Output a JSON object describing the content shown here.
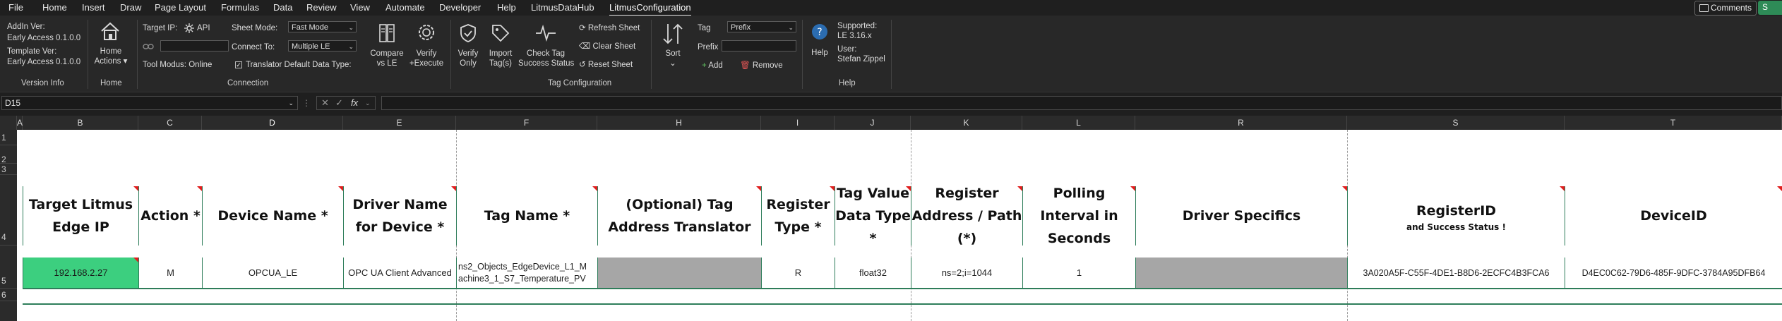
{
  "menu": {
    "items": [
      "File",
      "Home",
      "Insert",
      "Draw",
      "Page Layout",
      "Formulas",
      "Data",
      "Review",
      "View",
      "Automate",
      "Developer",
      "Help",
      "LitmusDataHub",
      "LitmusConfiguration"
    ],
    "active": "LitmusConfiguration",
    "comments_label": "Comments",
    "share_initial": "S"
  },
  "ribbon": {
    "version_info": {
      "addin_ver_label": "AddIn Ver:",
      "addin_ver_value": "Early Access 0.1.0.0",
      "template_ver_label": "Template Ver:",
      "template_ver_value": "Early Access 0.1.0.0",
      "group_label": "Version Info"
    },
    "home": {
      "button_line1": "Home",
      "button_line2": "Actions",
      "group_label": "Home"
    },
    "connection": {
      "target_ip_label": "Target IP:",
      "api_label": "API",
      "sheet_mode_label": "Sheet Mode:",
      "sheet_mode_value": "Fast Mode",
      "connect_to_label": "Connect To:",
      "connect_to_value": "Multiple LE",
      "tool_modus": "Tool Modus: Online",
      "translator_default": "Translator Default Data Type:",
      "compare_line1": "Compare",
      "compare_line2": "vs LE",
      "verify_line1": "Verify",
      "verify_line2": "+Execute",
      "group_label": "Connection"
    },
    "tag_config": {
      "verify_only_line1": "Verify",
      "verify_only_line2": "Only",
      "import_line1": "Import",
      "import_line2": "Tag(s)",
      "check_line1": "Check Tag",
      "check_line2": "Success Status",
      "refresh_sheet": "Refresh Sheet",
      "clear_sheet": "Clear Sheet",
      "reset_sheet": "Reset Sheet",
      "sort_label": "Sort",
      "tag_label": "Tag",
      "tag_value": "Prefix",
      "prefix_label": "Prefix",
      "add_label": "Add",
      "remove_label": "Remove",
      "group_label": "Tag Configuration"
    },
    "help": {
      "help_label": "Help",
      "supported_label": "Supported:",
      "supported_value": "LE 3.16.x",
      "user_label": "User:",
      "user_value": "Stefan Zippel",
      "group_label": "Help"
    }
  },
  "formula_bar": {
    "cell_ref": "D15",
    "fx": "fx",
    "formula": ""
  },
  "grid": {
    "columns": [
      "A",
      "B",
      "C",
      "D",
      "E",
      "F",
      "H",
      "I",
      "J",
      "K",
      "L",
      "R",
      "S",
      "T"
    ],
    "rows": [
      "1",
      "2",
      "3",
      "4",
      "5",
      "6"
    ],
    "headers": {
      "target_ip": "Target Litmus Edge IP",
      "action": "Action *",
      "device_name": "Device Name *",
      "driver_name": "Driver Name for Device *",
      "tag_name": "Tag Name *",
      "translator": "(Optional) Tag Address Translator",
      "register_type": "Register Type *",
      "value_type": "Tag Value Data Type *",
      "register_address": "Register Address / Path (*)",
      "polling": "Polling Interval in Seconds",
      "driver_specifics": "Driver Specifics",
      "register_id": "RegisterID",
      "register_id_sub": "and Success Status !",
      "device_id": "DeviceID"
    },
    "row5": {
      "target_ip": "192.168.2.27",
      "action": "M",
      "device_name": "OPCUA_LE",
      "driver_name": "OPC UA Client Advanced",
      "tag_name_line1": "ns2_Objects_EdgeDevice_L1_M",
      "tag_name_line2": "achine3_1_S7_Temperature_PV",
      "translator": "",
      "register_type": "R",
      "value_type": "float32",
      "register_address": "ns=2;i=1044",
      "polling": "1",
      "driver_specifics": "",
      "register_id": "3A020A5F-C55F-4DE1-B8D6-2ECFC4B3FCA6",
      "device_id": "D4EC0C62-79D6-485F-9DFC-3784A95DFB64"
    }
  },
  "colors": {
    "accent_green": "#3ccf7f",
    "comment_marker": "#e01e1e",
    "gray_cell": "#a6a6a6"
  }
}
